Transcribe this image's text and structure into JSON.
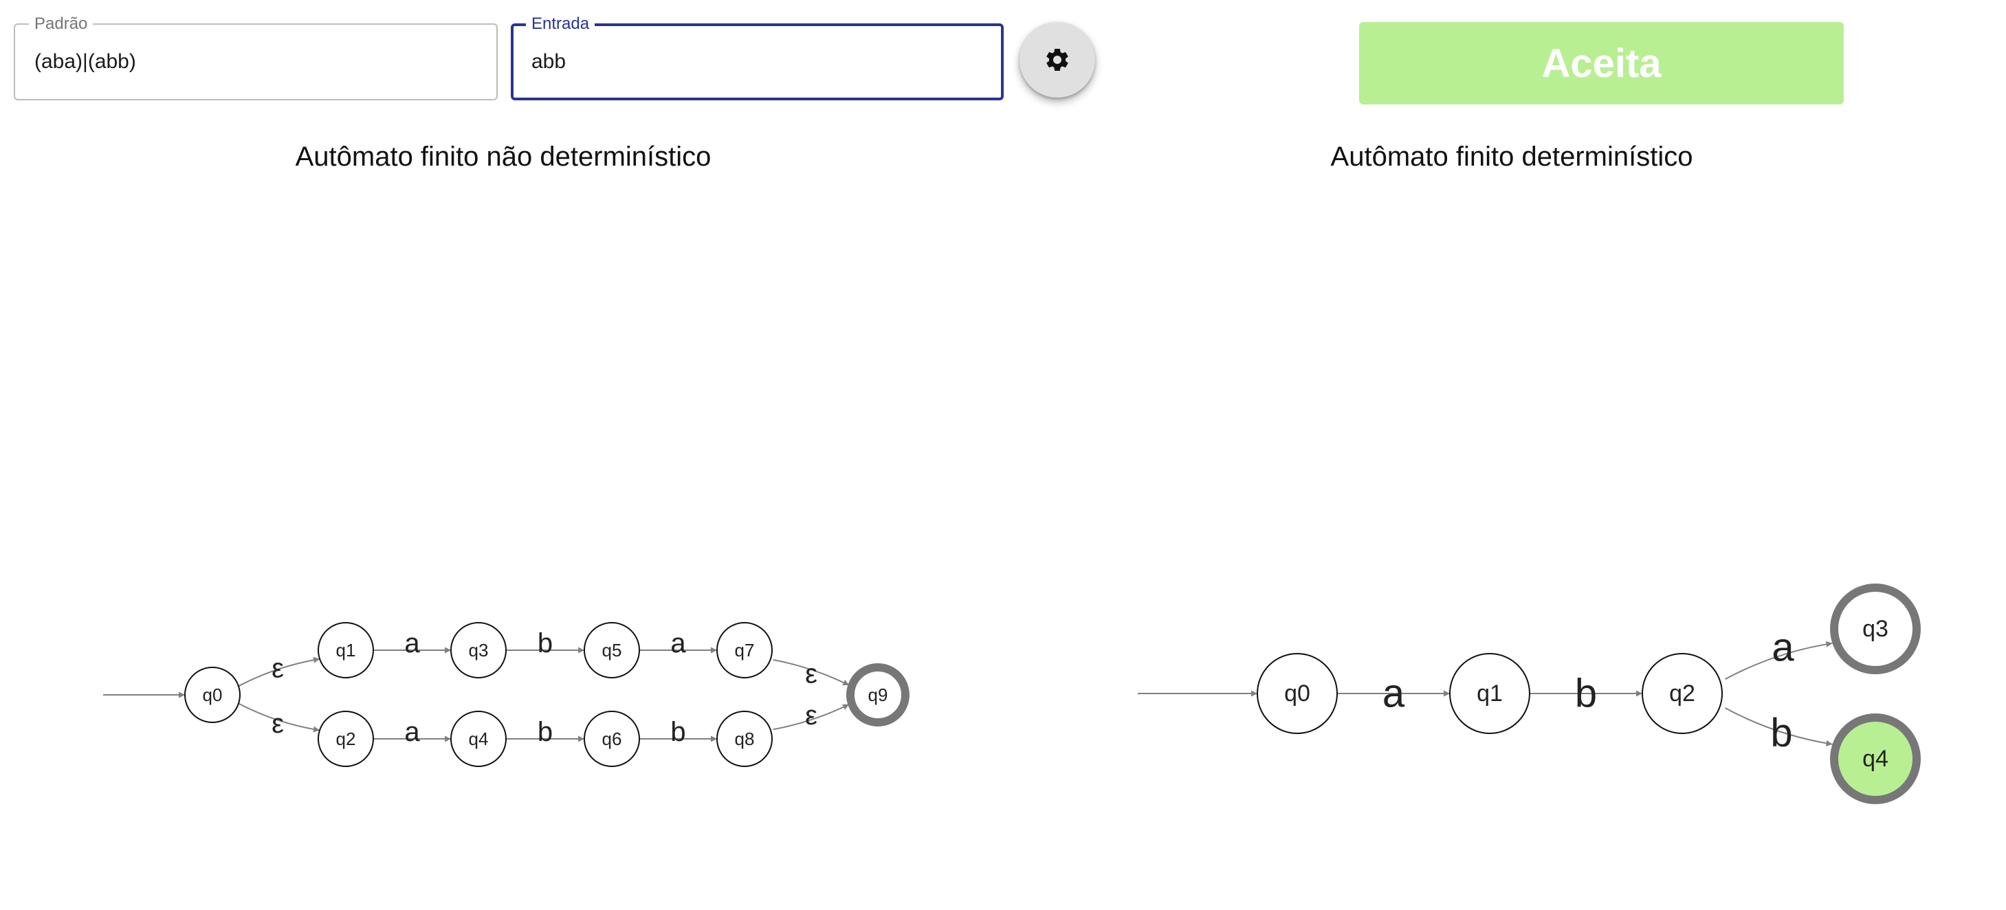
{
  "pattern_field": {
    "label": "Padrão",
    "value": "(aba)|(abb)"
  },
  "input_field": {
    "label": "Entrada",
    "value": "abb"
  },
  "settings_button": {
    "icon": "gear-icon"
  },
  "result": {
    "text": "Aceita",
    "color": "#b9ef93"
  },
  "nfa": {
    "title": "Autômato finito não determinístico",
    "states": [
      "q0",
      "q1",
      "q2",
      "q3",
      "q4",
      "q5",
      "q6",
      "q7",
      "q8",
      "q9"
    ],
    "transitions": [
      {
        "from": "q0",
        "to": "q1",
        "label": "ε"
      },
      {
        "from": "q0",
        "to": "q2",
        "label": "ε"
      },
      {
        "from": "q1",
        "to": "q3",
        "label": "a"
      },
      {
        "from": "q3",
        "to": "q5",
        "label": "b"
      },
      {
        "from": "q5",
        "to": "q7",
        "label": "a"
      },
      {
        "from": "q2",
        "to": "q4",
        "label": "a"
      },
      {
        "from": "q4",
        "to": "q6",
        "label": "b"
      },
      {
        "from": "q6",
        "to": "q8",
        "label": "b"
      },
      {
        "from": "q7",
        "to": "q9",
        "label": "ε"
      },
      {
        "from": "q8",
        "to": "q9",
        "label": "ε"
      }
    ],
    "start_state": "q0",
    "accepting_states": [
      "q9"
    ]
  },
  "dfa": {
    "title": "Autômato finito determinístico",
    "states": [
      "q0",
      "q1",
      "q2",
      "q3",
      "q4"
    ],
    "transitions": [
      {
        "from": "q0",
        "to": "q1",
        "label": "a"
      },
      {
        "from": "q1",
        "to": "q2",
        "label": "b"
      },
      {
        "from": "q2",
        "to": "q3",
        "label": "a"
      },
      {
        "from": "q2",
        "to": "q4",
        "label": "b"
      }
    ],
    "start_state": "q0",
    "accepting_states": [
      "q3",
      "q4"
    ],
    "current_state": "q4",
    "highlight_color": "#b9ef93"
  }
}
